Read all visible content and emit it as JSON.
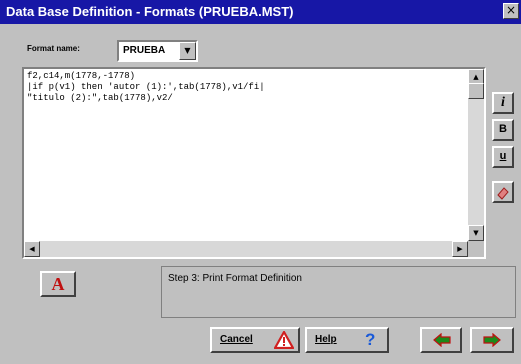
{
  "window": {
    "title": "Data Base Definition - Formats (PRUEBA.MST)",
    "close_glyph": "×"
  },
  "format": {
    "label": "Format name:",
    "value": "PRUEBA"
  },
  "editor": {
    "lines": [
      "f2,c14,m(1778,-1778)",
      "|if p(v1) then 'autor (1):',tab(1778),v1/fi|",
      "\"titulo (2):\",tab(1778),v2/"
    ]
  },
  "tools": {
    "italic": "i",
    "bold": "B",
    "underline": "u"
  },
  "preview_glyph": "A",
  "step": {
    "text": "Step 3: Print Format Definition"
  },
  "buttons": {
    "cancel": "Cancel",
    "help": "Help",
    "help_glyph": "?"
  },
  "colors": {
    "titlebar": "#1717a6",
    "face": "#c0c0c0",
    "warning_red": "#d02020",
    "help_blue": "#1a5ad8",
    "arrow_green": "#1a8a1a",
    "arrow_red": "#c01010"
  }
}
